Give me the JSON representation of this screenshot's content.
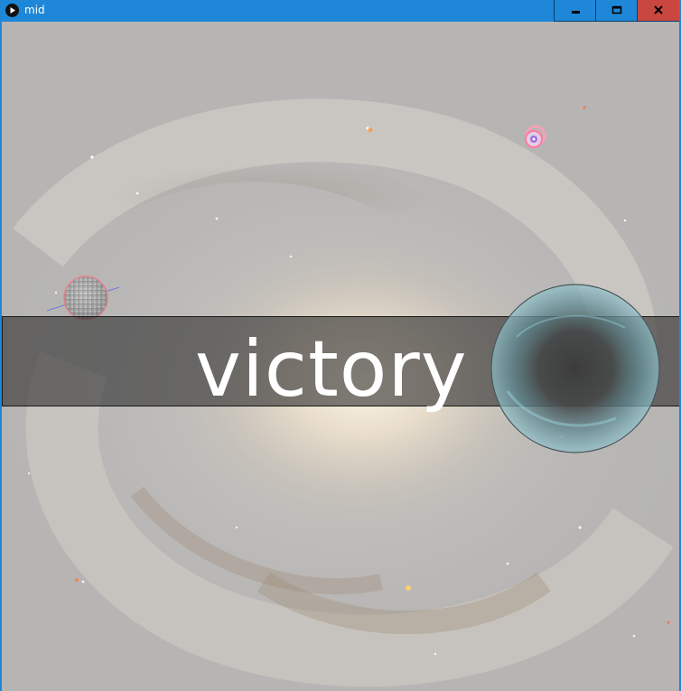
{
  "window": {
    "title": "mid",
    "app_icon": "play-icon",
    "controls": [
      "minimize-icon",
      "maximize-icon",
      "close-icon"
    ],
    "titlebar_color": "#1f87d8",
    "close_color": "#c9473f"
  },
  "game": {
    "background": "spiral-galaxy",
    "banner_text": "victory",
    "objects": [
      "player-ship",
      "target-orb",
      "black-hole"
    ]
  }
}
